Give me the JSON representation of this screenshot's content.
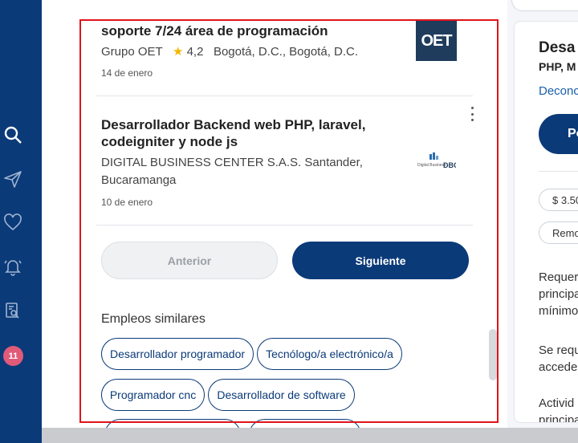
{
  "sidebar": {
    "icons": [
      "search-icon",
      "send-icon",
      "heart-icon",
      "bell-icon",
      "document-search-icon"
    ],
    "badge_count": "11"
  },
  "jobs": [
    {
      "title": "soporte 7/24 área de programación",
      "company": "Grupo OET",
      "rating": "4,2",
      "location": "Bogotá, D.C., Bogotá, D.C.",
      "date": "14 de enero",
      "logo_text": "OET"
    },
    {
      "title_line1": "Desarrollador Backend web PHP, laravel,",
      "title_line2": "codeigniter y node js",
      "company_line1": "DIGITAL BUSINESS CENTER S.A.S. Santander,",
      "company_line2": "Bucaramanga",
      "date": "10 de enero",
      "logo_text": "DBC"
    }
  ],
  "pagination": {
    "prev_label": "Anterior",
    "next_label": "Siguiente"
  },
  "similar": {
    "label": "Empleos similares",
    "chips": [
      "Desarrollador programador",
      "Tecnólogo/a electrónico/a",
      "Programador cnc",
      "Desarrollador de software"
    ]
  },
  "detail": {
    "title": "Desa",
    "subtitle": "PHP, M",
    "link": "Deconc",
    "apply_label": "Po",
    "salary_chip": "$ 3.50",
    "mode_chip": "Remo",
    "text1": [
      "Requer",
      "principa",
      "mínimo"
    ],
    "text2": [
      "Se requ",
      "acceder"
    ],
    "text3": [
      "Activid",
      "principa"
    ]
  },
  "colors": {
    "brand": "#0b3a78",
    "accent_star": "#f5b400",
    "badge": "#e05a79",
    "highlight_frame": "#e0141a"
  }
}
